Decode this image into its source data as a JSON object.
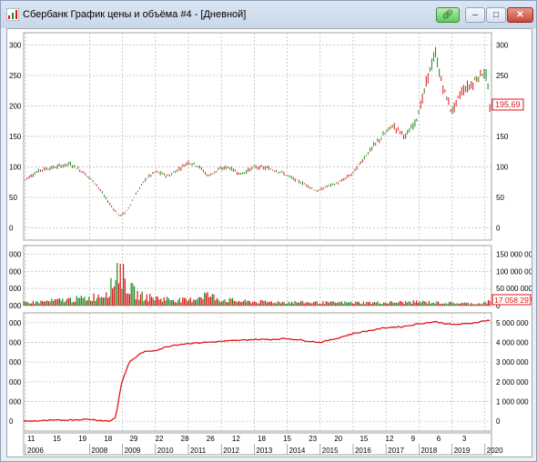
{
  "window": {
    "title": "Сбербанк График цены и объёма #4 - [Дневной]",
    "buttons": {
      "link": "link-icon",
      "minimize": "minimize-icon",
      "maximize": "maximize-icon",
      "close": "close-icon"
    }
  },
  "colors": {
    "up": "#1e8a1e",
    "down": "#e01515",
    "grid": "#b5b5b5",
    "equity_line": "#e01515"
  },
  "price_panel": {
    "y_ticks_left": [
      "300",
      "250",
      "200",
      "150",
      "100",
      "50",
      "0"
    ],
    "y_ticks_right": [
      "300",
      "250",
      "200",
      "150",
      "100",
      "50",
      "0"
    ],
    "last_price_label": "195,69"
  },
  "volume_panel": {
    "y_ticks_left": [
      "000",
      "000",
      "000",
      "000"
    ],
    "y_ticks_right": [
      "150 000 000",
      "100 000 000",
      "50 000 000",
      "0"
    ],
    "last_volume_label": "17 058 297"
  },
  "lower_panel": {
    "y_ticks_left": [
      "000",
      "000",
      "000",
      "000",
      "000",
      "0"
    ],
    "y_ticks_right": [
      "5 000 000",
      "4 000 000",
      "3 000 000",
      "2 000 000",
      "1 000 000",
      "0"
    ]
  },
  "x_axis": {
    "day_labels": [
      "11",
      "15",
      "19",
      "18",
      "29",
      "22",
      "28",
      "26",
      "12",
      "18",
      "15",
      "23",
      "20",
      "15",
      "12",
      "9",
      "6",
      "3"
    ],
    "year_labels": [
      "2006",
      "2008",
      "2009",
      "2010",
      "2011",
      "2012",
      "2013",
      "2014",
      "2015",
      "2016",
      "2017",
      "2018",
      "2019",
      "2020"
    ]
  },
  "chart_data": [
    {
      "type": "line",
      "title": "",
      "x_range": [
        2006.0,
        2020.2
      ],
      "ylim": [
        -20,
        320
      ],
      "series": [
        {
          "name": "",
          "x": [
            2006.0,
            2006.5,
            2007.0,
            2007.4,
            2007.8,
            2008.2,
            2008.6,
            2008.9,
            2009.1,
            2009.4,
            2009.7,
            2010.0,
            2010.4,
            2010.8,
            2011.0,
            2011.3,
            2011.6,
            2011.9,
            2012.2,
            2012.6,
            2013.0,
            2013.4,
            2013.8,
            2014.2,
            2014.6,
            2014.9,
            2015.2,
            2015.6,
            2016.0,
            2016.4,
            2016.8,
            2017.2,
            2017.6,
            2017.9,
            2018.1,
            2018.3,
            2018.5,
            2018.7,
            2019.0,
            2019.3,
            2019.6,
            2019.9,
            2020.05,
            2020.15
          ],
          "values": [
            78,
            95,
            100,
            105,
            92,
            72,
            40,
            20,
            25,
            55,
            80,
            92,
            85,
            100,
            108,
            102,
            85,
            95,
            100,
            88,
            100,
            98,
            92,
            80,
            70,
            60,
            68,
            75,
            90,
            120,
            145,
            168,
            150,
            175,
            210,
            255,
            285,
            235,
            190,
            225,
            235,
            255,
            250,
            195.69
          ]
        }
      ]
    },
    {
      "type": "bar",
      "title": "",
      "ylim": [
        0,
        175000000
      ],
      "x_range": [
        2006.0,
        2020.2
      ],
      "series": [
        {
          "name": "",
          "x": [
            2006.0,
            2006.5,
            2007.0,
            2007.5,
            2008.0,
            2008.4,
            2008.7,
            2008.85,
            2009.0,
            2009.2,
            2009.5,
            2010.0,
            2010.5,
            2011.0,
            2011.5,
            2012.0,
            2012.5,
            2013.0,
            2014.0,
            2015.0,
            2016.0,
            2017.0,
            2018.0,
            2019.0,
            2019.9,
            2020.15
          ],
          "values": [
            12000000,
            15000000,
            20000000,
            25000000,
            30000000,
            45000000,
            80000000,
            160000000,
            120000000,
            70000000,
            40000000,
            30000000,
            25000000,
            20000000,
            45000000,
            25000000,
            18000000,
            15000000,
            14000000,
            12000000,
            12000000,
            12000000,
            15000000,
            10000000,
            8000000,
            17058297
          ]
        }
      ]
    },
    {
      "type": "line",
      "title": "",
      "ylim": [
        -500000,
        5500000
      ],
      "x_range": [
        2006.0,
        2020.2
      ],
      "series": [
        {
          "name": "",
          "x": [
            2006.0,
            2007.0,
            2008.0,
            2008.6,
            2008.8,
            2008.95,
            2009.2,
            2009.6,
            2010.0,
            2010.5,
            2011.0,
            2011.5,
            2012.0,
            2012.5,
            2013.0,
            2013.5,
            2014.0,
            2014.5,
            2015.0,
            2015.5,
            2016.0,
            2016.5,
            2017.0,
            2017.5,
            2018.0,
            2018.5,
            2019.0,
            2019.5,
            2020.0,
            2020.15
          ],
          "values": [
            0,
            50000,
            100000,
            0,
            200000,
            1800000,
            3000000,
            3500000,
            3600000,
            3850000,
            3950000,
            4000000,
            4050000,
            4100000,
            4150000,
            4150000,
            4200000,
            4100000,
            4000000,
            4200000,
            4450000,
            4600000,
            4750000,
            4800000,
            4950000,
            5050000,
            4900000,
            4950000,
            5100000,
            5120000
          ]
        }
      ]
    }
  ]
}
